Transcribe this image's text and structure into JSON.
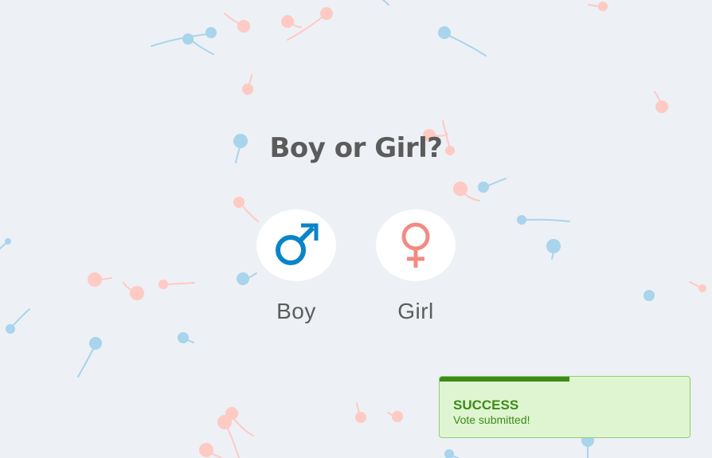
{
  "page": {
    "title": "Boy or Girl?"
  },
  "choices": [
    {
      "label": "Boy",
      "icon": "male-symbol-icon",
      "color": "#0a84c8"
    },
    {
      "label": "Girl",
      "icon": "female-symbol-icon",
      "color": "#f28b82"
    }
  ],
  "toast": {
    "title": "SUCCESS",
    "message": "Vote submitted!",
    "progress": 0.52,
    "accent_color": "#3d8b17",
    "background_color": "#dff5d2"
  },
  "background": {
    "color": "#edf0f4",
    "decoration_colors": [
      "#a8d4ec",
      "#ffc9c4"
    ]
  }
}
